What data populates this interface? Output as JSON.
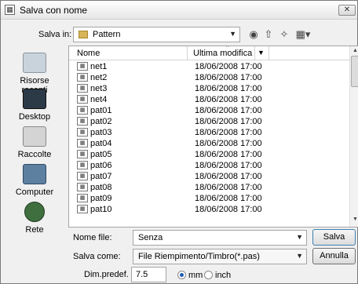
{
  "window": {
    "title": "Salva con nome",
    "close_label": "✕"
  },
  "toolbar": {
    "save_in_label": "Salva in:",
    "folder": "Pattern",
    "icons": [
      "back-icon",
      "up-folder-icon",
      "new-folder-icon",
      "views-menu-icon"
    ]
  },
  "places": [
    {
      "label": "Risorse recenti",
      "icon": "recent-icon"
    },
    {
      "label": "Desktop",
      "icon": "desktop-icon"
    },
    {
      "label": "Raccolte",
      "icon": "libraries-icon"
    },
    {
      "label": "Computer",
      "icon": "computer-icon"
    },
    {
      "label": "Rete",
      "icon": "network-icon"
    }
  ],
  "file_list": {
    "columns": [
      "Nome",
      "Ultima modifica"
    ],
    "rows": [
      {
        "name": "net1",
        "date": "18/06/2008 17:00"
      },
      {
        "name": "net2",
        "date": "18/06/2008 17:00"
      },
      {
        "name": "net3",
        "date": "18/06/2008 17:00"
      },
      {
        "name": "net4",
        "date": "18/06/2008 17:00"
      },
      {
        "name": "pat01",
        "date": "18/06/2008 17:00"
      },
      {
        "name": "pat02",
        "date": "18/06/2008 17:00"
      },
      {
        "name": "pat03",
        "date": "18/06/2008 17:00"
      },
      {
        "name": "pat04",
        "date": "18/06/2008 17:00"
      },
      {
        "name": "pat05",
        "date": "18/06/2008 17:00"
      },
      {
        "name": "pat06",
        "date": "18/06/2008 17:00"
      },
      {
        "name": "pat07",
        "date": "18/06/2008 17:00"
      },
      {
        "name": "pat08",
        "date": "18/06/2008 17:00"
      },
      {
        "name": "pat09",
        "date": "18/06/2008 17:00"
      },
      {
        "name": "pat10",
        "date": "18/06/2008 17:00"
      }
    ]
  },
  "form": {
    "filename_label": "Nome file:",
    "filename_value": "Senza",
    "filetype_label": "Salva come:",
    "filetype_value": "File Riempimento/Timbro(*.pas)",
    "save_button": "Salva",
    "cancel_button": "Annulla",
    "default_dim_label": "Dim.predef.",
    "default_dim_value": "7.5",
    "unit_mm": "mm",
    "unit_inch": "inch",
    "selected_unit": "mm"
  }
}
